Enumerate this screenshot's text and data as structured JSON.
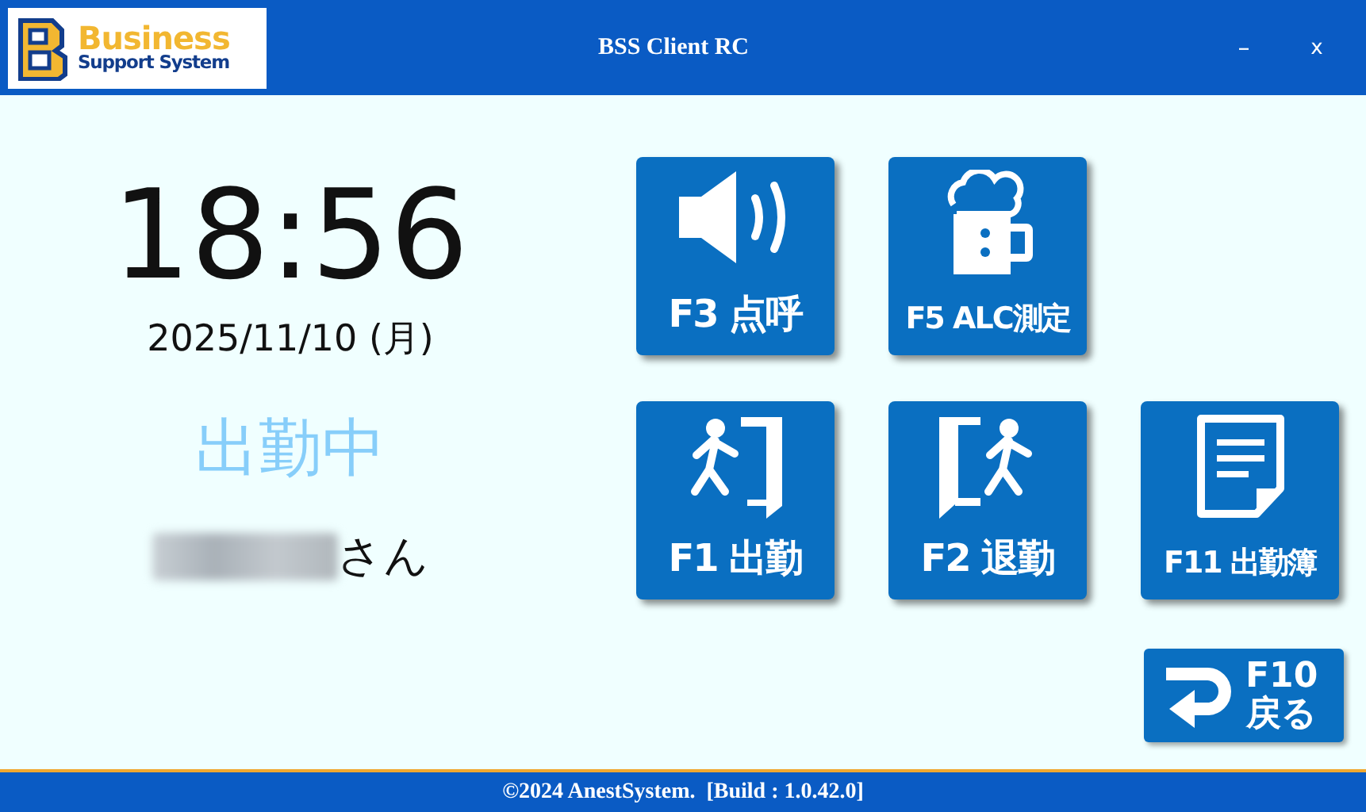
{
  "window": {
    "title": "BSS Client RC",
    "controls": [
      {
        "kind": "minimize",
        "glyph": "–"
      },
      {
        "kind": "close",
        "glyph": "x"
      }
    ]
  },
  "logo": {
    "line1": "Business",
    "line2": "Support System"
  },
  "clock": {
    "time": "18:56",
    "date": "2025/11/10 (月)",
    "status": "出勤中",
    "name_suffix": "さん"
  },
  "tile_rows": [
    [
      {
        "kind": "speaker",
        "label": "F3 点呼"
      },
      {
        "kind": "beer",
        "label": "F5 ALC測定"
      }
    ],
    [
      {
        "kind": "enter",
        "label": "F1 出勤"
      },
      {
        "kind": "exit",
        "label": "F2 退勤"
      },
      {
        "kind": "document",
        "label": "F11 出勤簿"
      }
    ]
  ],
  "back_button": {
    "lines": [
      "F10",
      "戻る"
    ]
  },
  "status_bar": "©2024 AnestSystem.  [Build : 1.0.42.0]"
}
